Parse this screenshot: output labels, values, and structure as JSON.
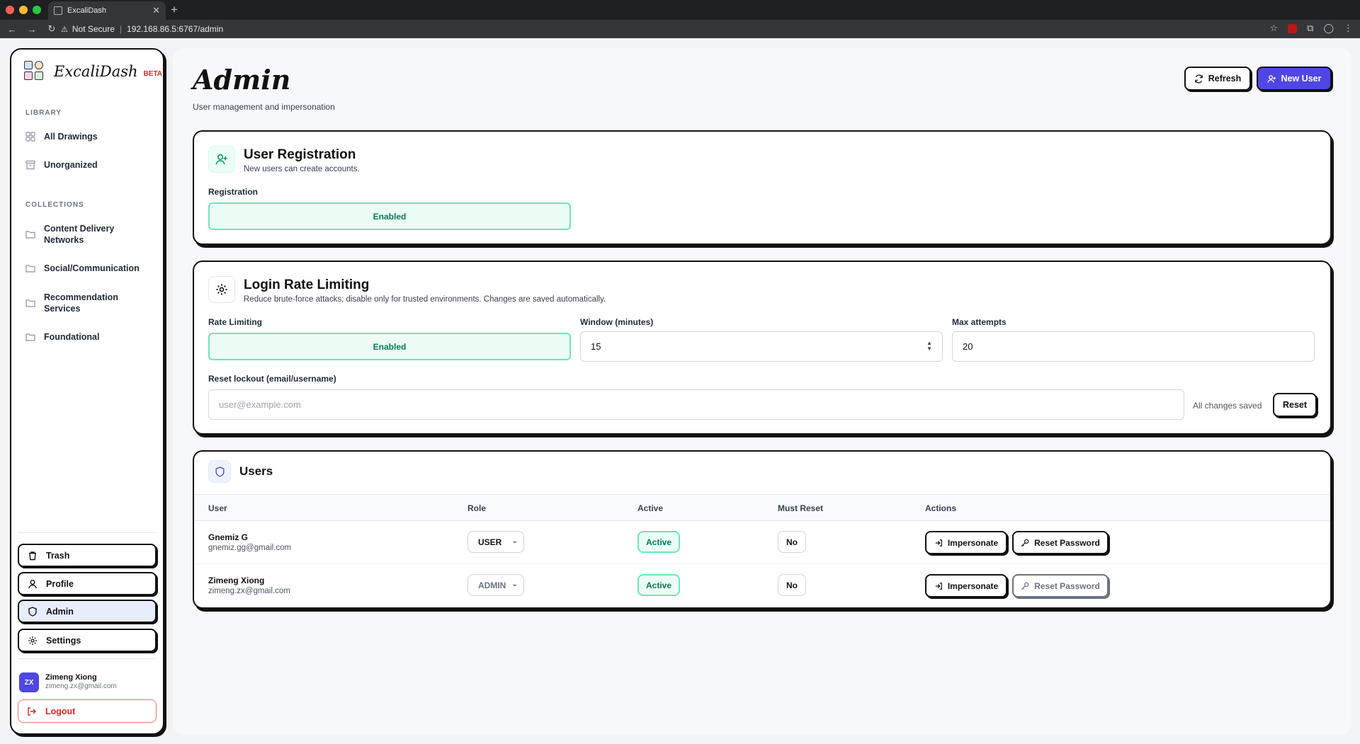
{
  "browser": {
    "tab_title": "ExcaliDash",
    "security_label": "Not Secure",
    "url": "192.168.86.5:6767/admin"
  },
  "sidebar": {
    "app_name": "ExcaliDash",
    "beta": "BETA",
    "library_label": "LIBRARY",
    "library_items": [
      {
        "label": "All Drawings",
        "icon": "grid-icon"
      },
      {
        "label": "Unorganized",
        "icon": "archive-icon"
      }
    ],
    "collections_label": "COLLECTIONS",
    "collections": [
      {
        "label": "Content Delivery Networks",
        "icon": "folder-icon"
      },
      {
        "label": "Social/Communication",
        "icon": "folder-icon"
      },
      {
        "label": "Recommendation Services",
        "icon": "folder-icon"
      },
      {
        "label": "Foundational",
        "icon": "folder-icon"
      }
    ],
    "bottom_nav": [
      {
        "label": "Trash",
        "icon": "trash-icon"
      },
      {
        "label": "Profile",
        "icon": "user-icon"
      },
      {
        "label": "Admin",
        "icon": "shield-icon",
        "active": true
      },
      {
        "label": "Settings",
        "icon": "gear-icon"
      }
    ],
    "user": {
      "initials": "ZX",
      "name": "Zimeng Xiong",
      "email": "zimeng.zx@gmail.com"
    },
    "logout_label": "Logout"
  },
  "header": {
    "title": "Admin",
    "subtitle": "User management and impersonation",
    "refresh_label": "Refresh",
    "new_user_label": "New User"
  },
  "registration": {
    "title": "User Registration",
    "subtitle": "New users can create accounts.",
    "field_label": "Registration",
    "toggle_value": "Enabled"
  },
  "rate_limiting": {
    "title": "Login Rate Limiting",
    "subtitle": "Reduce brute-force attacks; disable only for trusted environments. Changes are saved automatically.",
    "rate_label": "Rate Limiting",
    "rate_value": "Enabled",
    "window_label": "Window (minutes)",
    "window_value": "15",
    "max_label": "Max attempts",
    "max_value": "20",
    "reset_label": "Reset lockout (email/username)",
    "reset_placeholder": "user@example.com",
    "saved_status": "All changes saved",
    "reset_button": "Reset"
  },
  "users": {
    "title": "Users",
    "columns": [
      "User",
      "Role",
      "Active",
      "Must Reset",
      "Actions"
    ],
    "rows": [
      {
        "name": "Gnemiz G",
        "email": "gnemiz.gg@gmail.com",
        "role": "USER",
        "active": "Active",
        "must_reset": "No",
        "impersonate": "Impersonate",
        "reset_password": "Reset Password"
      },
      {
        "name": "Zimeng Xiong",
        "email": "zimeng.zx@gmail.com",
        "role": "ADMIN",
        "active": "Active",
        "must_reset": "No",
        "impersonate": "Impersonate",
        "reset_password": "Reset Password"
      }
    ]
  },
  "colors": {
    "accent": "#4f46e5",
    "success": "#047857",
    "danger": "#dc2626"
  }
}
